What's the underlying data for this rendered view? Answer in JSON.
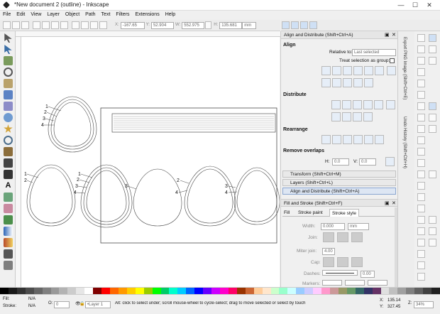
{
  "window": {
    "title": "*New document 2 (outline) - Inkscape",
    "minimize": "—",
    "maximize": "☐",
    "close": "✕"
  },
  "menu": [
    "File",
    "Edit",
    "View",
    "Layer",
    "Object",
    "Path",
    "Text",
    "Filters",
    "Extensions",
    "Help"
  ],
  "toolbar": {
    "x_label": "X:",
    "x": "-167.65",
    "y_label": "Y:",
    "y": "52.904",
    "w_label": "W:",
    "w": "552.975",
    "h_label": "H:",
    "h": "135.681",
    "units": "mm"
  },
  "canvas": {
    "labels": [
      {
        "text": "1"
      },
      {
        "text": "2"
      },
      {
        "text": "3"
      },
      {
        "text": "4"
      },
      {
        "text": "1"
      },
      {
        "text": "2"
      },
      {
        "text": "1"
      },
      {
        "text": "2"
      },
      {
        "text": "3"
      },
      {
        "text": "4"
      },
      {
        "text": "3"
      },
      {
        "text": "2"
      },
      {
        "text": "4"
      },
      {
        "text": "3"
      },
      {
        "text": "4"
      }
    ]
  },
  "align_panel": {
    "header": "Align and Distribute (Shift+Ctrl+A)",
    "align_title": "Align",
    "relative_to_label": "Relative to:",
    "relative_to_value": "Last selected",
    "treat_as_group": "Treat selection as group:",
    "distribute_title": "Distribute",
    "rearrange_title": "Rearrange",
    "remove_overlaps_title": "Remove overlaps",
    "h_label": "H:",
    "h_value": "0.0",
    "v_label": "V:",
    "v_value": "0.0"
  },
  "collapsed_panels": [
    "Transform (Shift+Ctrl+M)",
    "Layers (Shift+Ctrl+L)",
    "Align and Distribute (Shift+Ctrl+A)"
  ],
  "fill_stroke": {
    "header": "Fill and Stroke (Shift+Ctrl+F)",
    "tabs": [
      "Fill",
      "Stroke paint",
      "Stroke style"
    ],
    "width_label": "Width:",
    "width_value": "0.000",
    "width_unit": "mm",
    "join_label": "Join:",
    "miter_label": "Miter join:",
    "miter_value": "4.00",
    "cap_label": "Cap:",
    "dashes_label": "Dashes:",
    "dashes_value": "0.00",
    "markers_label": "Markers:"
  },
  "side_tabs": [
    "Export PNG Image (Shift+Ctrl+E)",
    "Undo History (Shift+Ctrl+H)"
  ],
  "status": {
    "fill_label": "Fill:",
    "fill_value": "N/A",
    "stroke_label": "Stroke:",
    "stroke_value": "N/A",
    "opacity_label": "O:",
    "opacity_value": "0",
    "layer": "•Layer 1",
    "message": "Alt: click to select under; scroll mouse-wheel to cycle-select; drag to move selected or select by touch",
    "x_label": "X:",
    "x": "135.14",
    "y_label": "Y:",
    "y": "327.45",
    "z_label": "Z:",
    "zoom": "34%"
  },
  "palette_colors": [
    "#000000",
    "#1a1a1a",
    "#333333",
    "#4d4d4d",
    "#666666",
    "#808080",
    "#999999",
    "#b3b3b3",
    "#cccccc",
    "#e6e6e6",
    "#ffffff",
    "#800000",
    "#ff0000",
    "#ff6600",
    "#ff9900",
    "#ffcc00",
    "#ffff00",
    "#99cc00",
    "#00ff00",
    "#00cc66",
    "#00ffcc",
    "#00ccff",
    "#0066ff",
    "#0000ff",
    "#6600ff",
    "#cc00ff",
    "#ff00cc",
    "#ff0066",
    "#993300",
    "#cc6633",
    "#ffcc99",
    "#ffe6cc",
    "#ccffcc",
    "#99ffcc",
    "#ccffff",
    "#99ccff",
    "#ccccff",
    "#ffccff",
    "#ff99cc",
    "#cc9999",
    "#999966",
    "#669966",
    "#336666",
    "#333366",
    "#663366",
    "#e0e0e0",
    "#c0c0c0",
    "#a0a0a0",
    "#808080",
    "#606060",
    "#404040",
    "#202020"
  ]
}
